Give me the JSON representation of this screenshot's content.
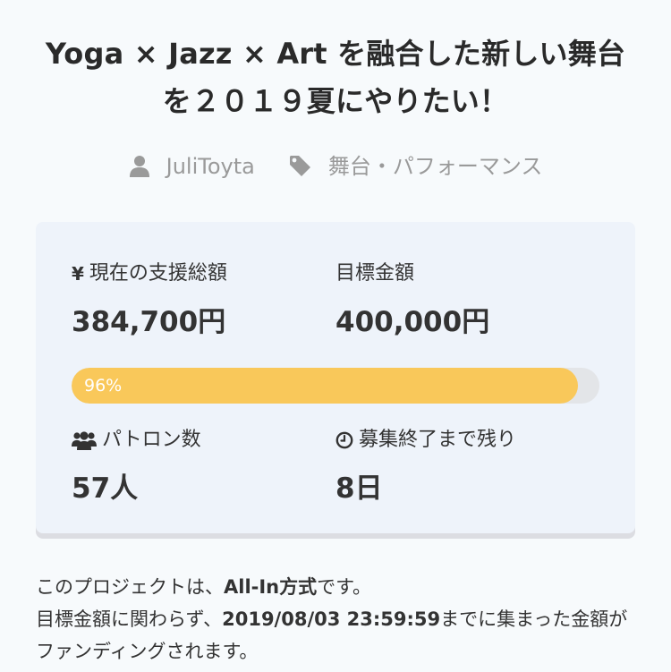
{
  "project": {
    "title_line1": "Yoga × Jazz × Art を融合した新しい舞台",
    "title_line2": "を２０１９夏にやりたい！",
    "author": "JuliToyta",
    "category": "舞台・パフォーマンス"
  },
  "stats": {
    "current_label": "現在の支援総額",
    "current_value": "384,700円",
    "goal_label": "目標金額",
    "goal_value": "400,000円",
    "progress_percent": 96,
    "progress_text": "96%",
    "patrons_label": "パトロン数",
    "patrons_value": "57人",
    "remaining_label": "募集終了まで残り",
    "remaining_value": "8日"
  },
  "notice": {
    "p1_before": "このプロジェクトは、",
    "p1_bold": "All-In方式",
    "p1_after": "です。",
    "p2_before": "目標金額に関わらず、",
    "p2_bold": "2019/08/03 23:59:59",
    "p2_after": "までに集まった金額がファンディングされます。"
  },
  "icons": {
    "author": "user-icon",
    "category": "tag-icon",
    "current": "yen-icon",
    "patrons": "users-icon",
    "remaining": "clock-icon"
  },
  "colors": {
    "progress_fill": "#f9c85a",
    "progress_track": "#e3e5e8",
    "card_bg": "#eef3fa",
    "meta_text": "#9a9a9a"
  }
}
